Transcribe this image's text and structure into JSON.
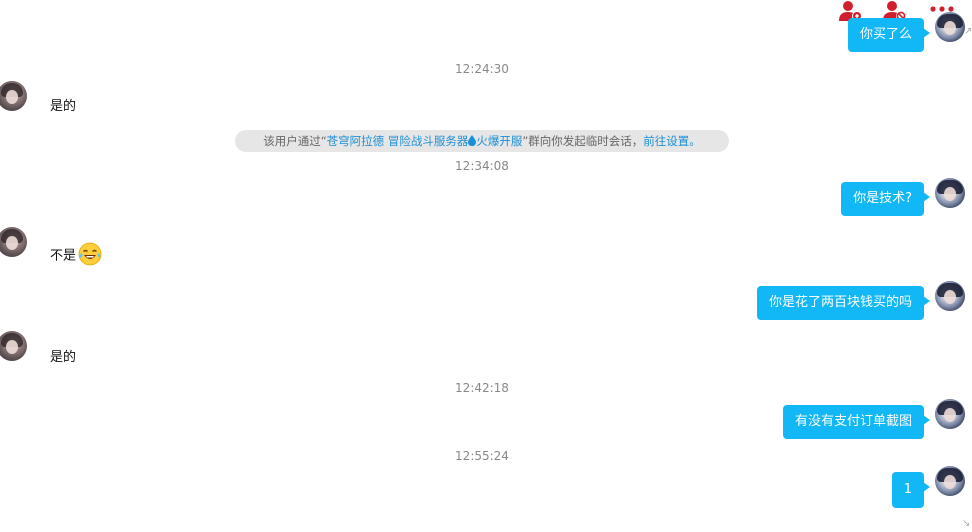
{
  "toolbar": {
    "icons": [
      "add-contact-icon",
      "block-contact-icon",
      "more-options-icon"
    ],
    "accent": "#d0202e"
  },
  "colors": {
    "bubble": "#12b7f5",
    "link": "#1d8fd6"
  },
  "messages": {
    "top_partial": "你买了么",
    "ts1": "12:24:30",
    "m1": "是的",
    "notice": {
      "prefix": "该用户通过“",
      "group_name": "苍穹阿拉德 冒险战斗服务器",
      "group_suffix": "火爆开服",
      "middle": "”群向你发起临时会话，",
      "link": "前往设置。"
    },
    "ts2": "12:34:08",
    "m2": "你是技术?",
    "m3": "不是",
    "m4": "你是花了两百块钱买的吗",
    "m5": "是的",
    "ts3": "12:42:18",
    "m6": "有没有支付订单截图",
    "ts4": "12:55:24",
    "m7": "1"
  }
}
